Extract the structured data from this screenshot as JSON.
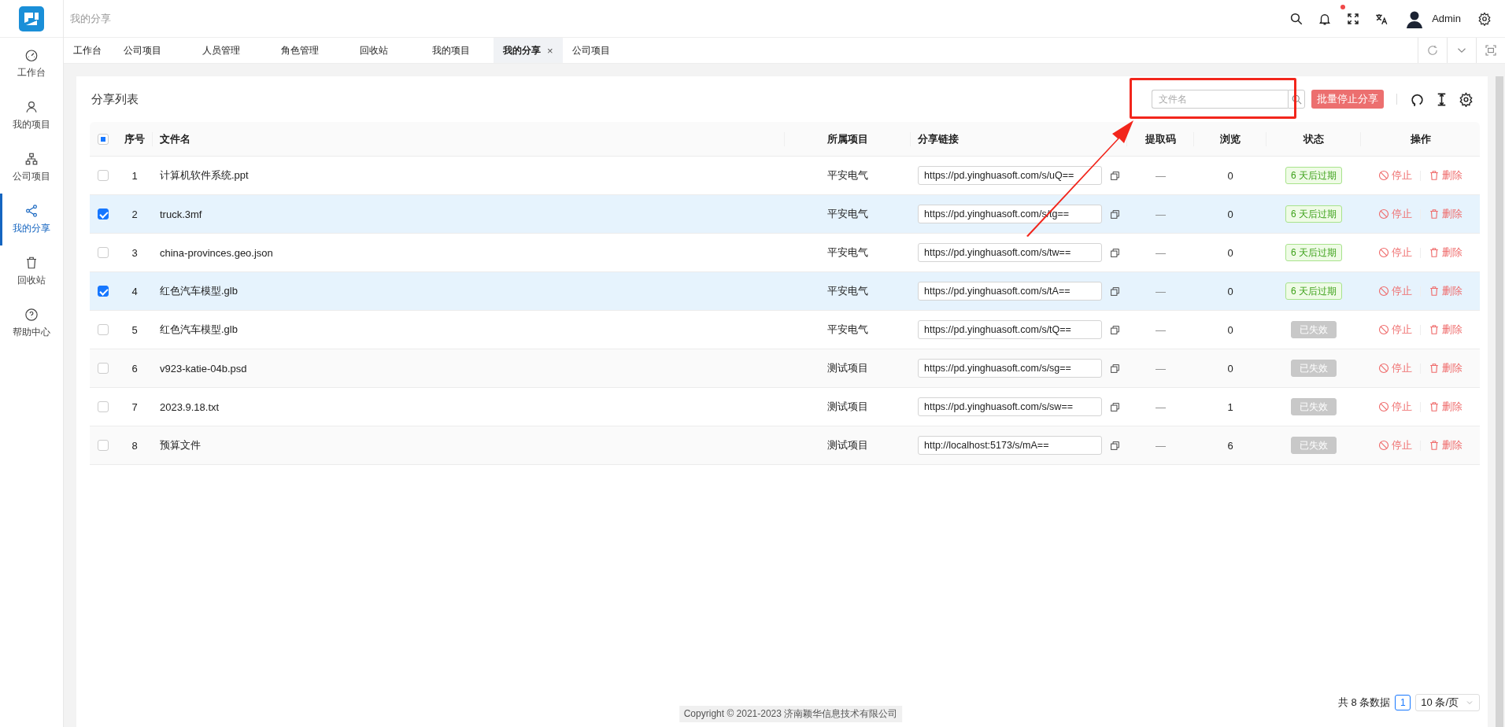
{
  "header": {
    "breadcrumb": "我的分享",
    "unread": true,
    "user": "Admin"
  },
  "sidebar": {
    "items": [
      {
        "label": "工作台",
        "selected": false
      },
      {
        "label": "我的项目",
        "selected": false
      },
      {
        "label": "公司项目",
        "selected": false
      },
      {
        "label": "我的分享",
        "selected": true
      },
      {
        "label": "回收站",
        "selected": false
      },
      {
        "label": "帮助中心",
        "selected": false
      }
    ]
  },
  "tabs": [
    {
      "label": "工作台",
      "selected": false
    },
    {
      "label": "公司项目",
      "selected": false
    },
    {
      "label": "人员管理",
      "selected": false
    },
    {
      "label": "角色管理",
      "selected": false
    },
    {
      "label": "回收站",
      "selected": false
    },
    {
      "label": "我的项目",
      "selected": false
    },
    {
      "label": "我的分享",
      "selected": true,
      "close": "×"
    },
    {
      "label": "公司项目",
      "selected": false
    }
  ],
  "panel": {
    "title": "分享列表",
    "search": {
      "placeholder": "文件名"
    },
    "batch_button": "批量停止分享"
  },
  "table": {
    "partially_selected": true,
    "columns": [
      "序号",
      "文件名",
      "所属项目",
      "分享链接",
      "提取码",
      "浏览",
      "状态",
      "操作"
    ],
    "rows": [
      {
        "index": "1",
        "file": "计算机软件系统.ppt",
        "project": "平安电气",
        "link": "https://pd.yinghuasoft.com/s/uQ==",
        "code": "—",
        "views": "0",
        "status": "6 天后过期",
        "expired": false,
        "selected": false,
        "actions": [
          "停止",
          "删除"
        ]
      },
      {
        "index": "2",
        "file": "truck.3mf",
        "project": "平安电气",
        "link": "https://pd.yinghuasoft.com/s/tg==",
        "code": "—",
        "views": "0",
        "status": "6 天后过期",
        "expired": false,
        "selected": true,
        "actions": [
          "停止",
          "删除"
        ]
      },
      {
        "index": "3",
        "file": "china-provinces.geo.json",
        "project": "平安电气",
        "link": "https://pd.yinghuasoft.com/s/tw==",
        "code": "—",
        "views": "0",
        "status": "6 天后过期",
        "expired": false,
        "selected": false,
        "actions": [
          "停止",
          "删除"
        ]
      },
      {
        "index": "4",
        "file": "红色汽车模型.glb",
        "project": "平安电气",
        "link": "https://pd.yinghuasoft.com/s/tA==",
        "code": "—",
        "views": "0",
        "status": "6 天后过期",
        "expired": false,
        "selected": true,
        "actions": [
          "停止",
          "删除"
        ]
      },
      {
        "index": "5",
        "file": "红色汽车模型.glb",
        "project": "平安电气",
        "link": "https://pd.yinghuasoft.com/s/tQ==",
        "code": "—",
        "views": "0",
        "status": "已失效",
        "expired": true,
        "selected": false,
        "actions": [
          "停止",
          "删除"
        ]
      },
      {
        "index": "6",
        "file": "v923-katie-04b.psd",
        "project": "测试项目",
        "link": "https://pd.yinghuasoft.com/s/sg==",
        "code": "—",
        "views": "0",
        "status": "已失效",
        "expired": true,
        "selected": false,
        "actions": [
          "停止",
          "删除"
        ]
      },
      {
        "index": "7",
        "file": "2023.9.18.txt",
        "project": "测试项目",
        "link": "https://pd.yinghuasoft.com/s/sw==",
        "code": "—",
        "views": "1",
        "status": "已失效",
        "expired": true,
        "selected": false,
        "actions": [
          "停止",
          "删除"
        ]
      },
      {
        "index": "8",
        "file": "预算文件",
        "project": "测试项目",
        "link": "http://localhost:5173/s/mA==",
        "code": "—",
        "views": "6",
        "status": "已失效",
        "expired": true,
        "selected": false,
        "actions": [
          "停止",
          "删除"
        ]
      }
    ]
  },
  "pagination": {
    "total": "共 8 条数据",
    "pages": [
      {
        "label": "1",
        "selected": true
      }
    ],
    "page_size": "10 条/页"
  },
  "footer": {
    "copyright": "Copyright © 2021-2023 济南颖华信息技术有限公司"
  }
}
